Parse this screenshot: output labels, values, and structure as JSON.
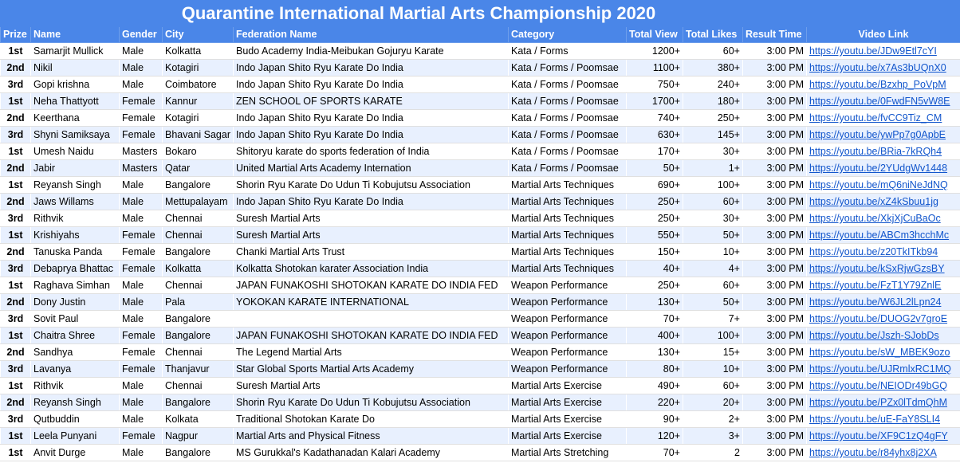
{
  "title": "Quarantine International Martial Arts Championship 2020",
  "headers": {
    "prize": "Prize",
    "name": "Name",
    "gender": "Gender",
    "city": "City",
    "federation": "Federation Name",
    "category": "Category",
    "views": "Total View",
    "likes": "Total Likes",
    "time": "Result Time",
    "link": "Video Link"
  },
  "rows": [
    {
      "prize": "1st",
      "name": "Samarjit Mullick",
      "gender": "Male",
      "city": "Kolkatta",
      "federation": "Budo Academy India-Meibukan Gojuryu Karate",
      "category": "Kata / Forms",
      "views": "1200+",
      "likes": "60+",
      "time": "3:00 PM",
      "link": "https://youtu.be/JDw9Etl7cYI"
    },
    {
      "prize": "2nd",
      "name": "Nikil",
      "gender": "Male",
      "city": "Kotagiri",
      "federation": "Indo Japan Shito Ryu Karate Do India",
      "category": "Kata / Forms / Poomsae",
      "views": "1100+",
      "likes": "380+",
      "time": "3:00 PM",
      "link": "https://youtu.be/x7As3bUQnX0"
    },
    {
      "prize": "3rd",
      "name": "Gopi krishna",
      "gender": "Male",
      "city": "Coimbatore",
      "federation": "Indo Japan Shito Ryu Karate Do India",
      "category": "Kata / Forms / Poomsae",
      "views": "750+",
      "likes": "240+",
      "time": "3:00 PM",
      "link": "https://youtu.be/Bzxhp_PoVpM"
    },
    {
      "prize": "1st",
      "name": "Neha Thattyott",
      "gender": "Female",
      "city": "Kannur",
      "federation": "ZEN SCHOOL OF SPORTS KARATE",
      "category": "Kata / Forms / Poomsae",
      "views": "1700+",
      "likes": "180+",
      "time": "3:00 PM",
      "link": "https://youtu.be/0FwdFN5vW8E"
    },
    {
      "prize": "2nd",
      "name": "Keerthana",
      "gender": "Female",
      "city": "Kotagiri",
      "federation": "Indo Japan Shito Ryu Karate Do India",
      "category": "Kata / Forms / Poomsae",
      "views": "740+",
      "likes": "250+",
      "time": "3:00 PM",
      "link": "https://youtu.be/fvCC9Tiz_CM"
    },
    {
      "prize": "3rd",
      "name": "Shyni Samiksaya",
      "gender": "Female",
      "city": "Bhavani Sagar",
      "federation": "Indo Japan Shito Ryu Karate Do India",
      "category": "Kata / Forms / Poomsae",
      "views": "630+",
      "likes": "145+",
      "time": "3:00 PM",
      "link": "https://youtu.be/ywPp7g0ApbE"
    },
    {
      "prize": "1st",
      "name": "Umesh Naidu",
      "gender": "Masters",
      "city": "Bokaro",
      "federation": "Shitoryu karate do sports federation of India",
      "category": "Kata / Forms / Poomsae",
      "views": "170+",
      "likes": "30+",
      "time": "3:00 PM",
      "link": "https://youtu.be/BRia-7kRQh4"
    },
    {
      "prize": "2nd",
      "name": "Jabir",
      "gender": "Masters",
      "city": "Qatar",
      "federation": "United Martial Arts Academy Internation",
      "category": "Kata / Forms / Poomsae",
      "views": "50+",
      "likes": "1+",
      "time": "3:00 PM",
      "link": "https://youtu.be/2YUdgWv1448"
    },
    {
      "prize": "1st",
      "name": "Reyansh Singh",
      "gender": "Male",
      "city": "Bangalore",
      "federation": "Shorin Ryu Karate Do Udun Ti Kobujutsu Association",
      "category": "Martial Arts Techniques",
      "views": "690+",
      "likes": "100+",
      "time": "3:00 PM",
      "link": "https://youtu.be/mQ6niNeJdNQ"
    },
    {
      "prize": "2nd",
      "name": "Jaws Willams",
      "gender": "Male",
      "city": "Mettupalayam",
      "federation": "Indo Japan Shito Ryu Karate Do India",
      "category": "Martial Arts Techniques",
      "views": "250+",
      "likes": "60+",
      "time": "3:00 PM",
      "link": "https://youtu.be/xZ4kSbuu1jg"
    },
    {
      "prize": "3rd",
      "name": "Rithvik",
      "gender": "Male",
      "city": "Chennai",
      "federation": "Suresh Martial Arts",
      "category": "Martial Arts Techniques",
      "views": "250+",
      "likes": "30+",
      "time": "3:00 PM",
      "link": "https://youtu.be/XkjXjCuBaOc"
    },
    {
      "prize": "1st",
      "name": "Krishiyahs",
      "gender": "Female",
      "city": "Chennai",
      "federation": "Suresh Martial Arts",
      "category": "Martial Arts Techniques",
      "views": "550+",
      "likes": "50+",
      "time": "3:00 PM",
      "link": "https://youtu.be/ABCm3hcchMc"
    },
    {
      "prize": "2nd",
      "name": "Tanuska Panda",
      "gender": "Female",
      "city": "Bangalore",
      "federation": "Chanki Martial Arts Trust",
      "category": "Martial Arts Techniques",
      "views": "150+",
      "likes": "10+",
      "time": "3:00 PM",
      "link": "https://youtu.be/z20TkITkb94"
    },
    {
      "prize": "3rd",
      "name": "Debaprya  Bhattac",
      "gender": "Female",
      "city": "Kolkatta",
      "federation": "Kolkatta Shotokan karater Association India",
      "category": "Martial Arts Techniques",
      "views": "40+",
      "likes": "4+",
      "time": "3:00 PM",
      "link": "https://youtu.be/kSxRjwGzsBY"
    },
    {
      "prize": "1st",
      "name": "Raghava Simhan",
      "gender": "Male",
      "city": "Chennai",
      "federation": "JAPAN FUNAKOSHI SHOTOKAN KARATE DO INDIA FED",
      "category": "Weapon Performance",
      "views": "250+",
      "likes": "60+",
      "time": "3:00 PM",
      "link": "https://youtu.be/FzT1Y79ZnlE"
    },
    {
      "prize": "2nd",
      "name": "Dony Justin",
      "gender": "Male",
      "city": "Pala",
      "federation": "YOKOKAN KARATE INTERNATIONAL",
      "category": "Weapon Performance",
      "views": "130+",
      "likes": "50+",
      "time": "3:00 PM",
      "link": "https://youtu.be/W6JL2lLpn24"
    },
    {
      "prize": "3rd",
      "name": "Sovit Paul",
      "gender": "Male",
      "city": "Bangalore",
      "federation": "",
      "category": "Weapon Performance",
      "views": "70+",
      "likes": "7+",
      "time": "3:00 PM",
      "link": "https://youtu.be/DUOG2v7groE"
    },
    {
      "prize": "1st",
      "name": "Chaitra Shree",
      "gender": "Female",
      "city": "Bangalore",
      "federation": "JAPAN FUNAKOSHI SHOTOKAN KARATE DO INDIA FED",
      "category": "Weapon Performance",
      "views": "400+",
      "likes": "100+",
      "time": "3:00 PM",
      "link": "https://youtu.be/Jszh-SJobDs"
    },
    {
      "prize": "2nd",
      "name": "Sandhya",
      "gender": "Female",
      "city": "Chennai",
      "federation": "The Legend Martial Arts",
      "category": "Weapon Performance",
      "views": "130+",
      "likes": "15+",
      "time": "3:00 PM",
      "link": "https://youtu.be/sW_MBEK9ozo"
    },
    {
      "prize": "3rd",
      "name": "Lavanya",
      "gender": "Female",
      "city": "Thanjavur",
      "federation": "Star Global Sports Martial Arts Academy",
      "category": "Weapon Performance",
      "views": "80+",
      "likes": "10+",
      "time": "3:00 PM",
      "link": "https://youtu.be/UJRmlxRC1MQ"
    },
    {
      "prize": "1st",
      "name": "Rithvik",
      "gender": "Male",
      "city": "Chennai",
      "federation": "Suresh Martial Arts",
      "category": "Martial Arts Exercise",
      "views": "490+",
      "likes": "60+",
      "time": "3:00 PM",
      "link": "https://youtu.be/NEIODr49bGQ"
    },
    {
      "prize": "2nd",
      "name": "Reyansh Singh",
      "gender": "Male",
      "city": "Bangalore",
      "federation": "Shorin Ryu Karate Do Udun Ti Kobujutsu Association",
      "category": "Martial Arts Exercise",
      "views": "220+",
      "likes": "20+",
      "time": "3:00 PM",
      "link": "https://youtu.be/PZx0lTdmQhM"
    },
    {
      "prize": "3rd",
      "name": "Qutbuddin",
      "gender": "Male",
      "city": "Kolkata",
      "federation": "Traditional Shotokan Karate Do",
      "category": "Martial Arts Exercise",
      "views": "90+",
      "likes": "2+",
      "time": "3:00 PM",
      "link": "https://youtu.be/uE-FaY8SLI4"
    },
    {
      "prize": "1st",
      "name": "Leela Punyani",
      "gender": "Female",
      "city": "Nagpur",
      "federation": "Martial Arts and Physical Fitness",
      "category": "Martial Arts Exercise",
      "views": "120+",
      "likes": "3+",
      "time": "3:00 PM",
      "link": "https://youtu.be/XF9C1zQ4gFY"
    },
    {
      "prize": "1st",
      "name": "Anvit Durge",
      "gender": "Male",
      "city": "Bangalore",
      "federation": "MS Gurukkal's Kadathanadan Kalari Academy",
      "category": "Martial Arts Stretching",
      "views": "70+",
      "likes": "2",
      "time": "3:00 PM",
      "link": "https://youtu.be/r84yhx8j2XA"
    }
  ]
}
